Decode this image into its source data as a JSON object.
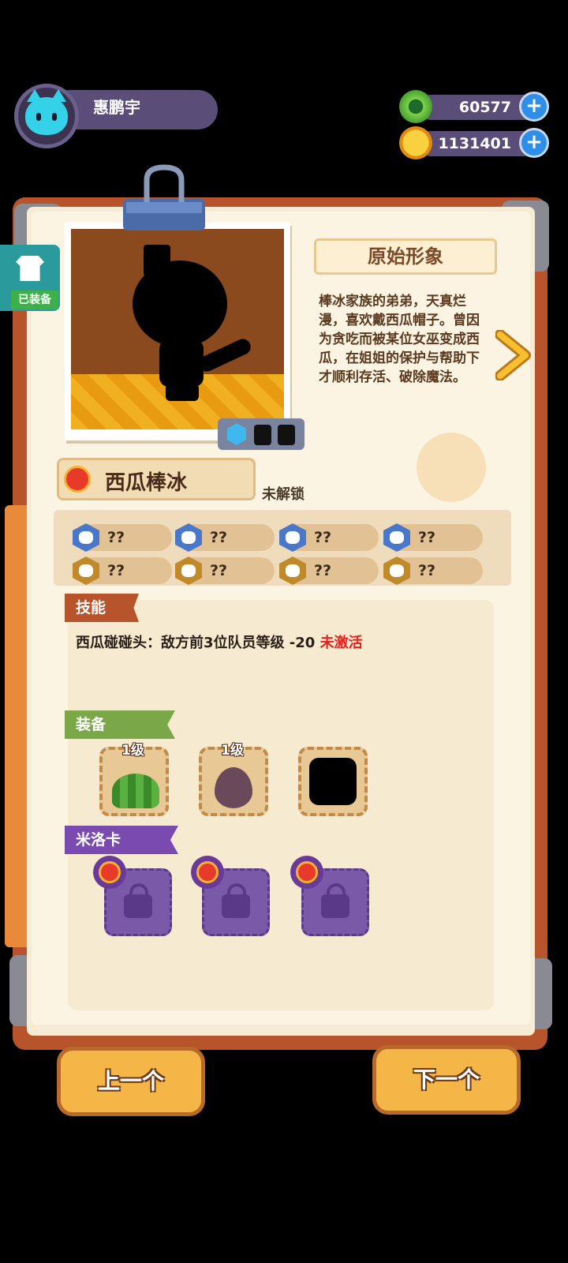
{
  "header": {
    "player_name": "惠鹏宇",
    "currencies": [
      {
        "icon": "green-coin-icon",
        "value": "60577",
        "color": "#7ed44a"
      },
      {
        "icon": "gold-planet-coin-icon",
        "value": "1131401",
        "color": "#f5b020"
      }
    ]
  },
  "side_tab": {
    "label": "已装备"
  },
  "character": {
    "form_title": "原始形象",
    "description": "棒冰家族的弟弟，天真烂漫，喜欢戴西瓜帽子。曾因为贪吃而被某位女巫变成西瓜，在姐姐的保护与帮助下才顺利存活、破除魔法。",
    "name": "西瓜棒冰",
    "status": "未解锁"
  },
  "stats": [
    {
      "icon": "heart-icon",
      "value": "??",
      "color": "#4a78c8"
    },
    {
      "icon": "sword-icon",
      "value": "??",
      "color": "#4a78c8"
    },
    {
      "icon": "shield-icon",
      "value": "??",
      "color": "#4a78c8"
    },
    {
      "icon": "anchor-icon",
      "value": "??",
      "color": "#4a78c8"
    },
    {
      "icon": "gear-icon",
      "value": "??",
      "color": "#c08a2a"
    },
    {
      "icon": "smile-icon",
      "value": "??",
      "color": "#c08a2a"
    },
    {
      "icon": "muscle-icon",
      "value": "??",
      "color": "#c08a2a"
    },
    {
      "icon": "swirl-icon",
      "value": "??",
      "color": "#c08a2a"
    }
  ],
  "skill": {
    "tag": "技能",
    "text": "西瓜碰碰头：敌方前3位队员等级 -20",
    "state": "未激活"
  },
  "equipment": {
    "tag": "装备",
    "slots": [
      {
        "level": "1级",
        "icon": "watermelon-hat-icon"
      },
      {
        "level": "1级",
        "icon": "seed-icon"
      },
      {
        "level": "",
        "icon": "empty-slot-icon"
      }
    ]
  },
  "miloca": {
    "tag": "米洛卡",
    "slots": [
      {
        "icon": "lock-icon"
      },
      {
        "icon": "lock-icon"
      },
      {
        "icon": "lock-icon"
      }
    ]
  },
  "nav": {
    "prev": "上一个",
    "next": "下一个"
  }
}
